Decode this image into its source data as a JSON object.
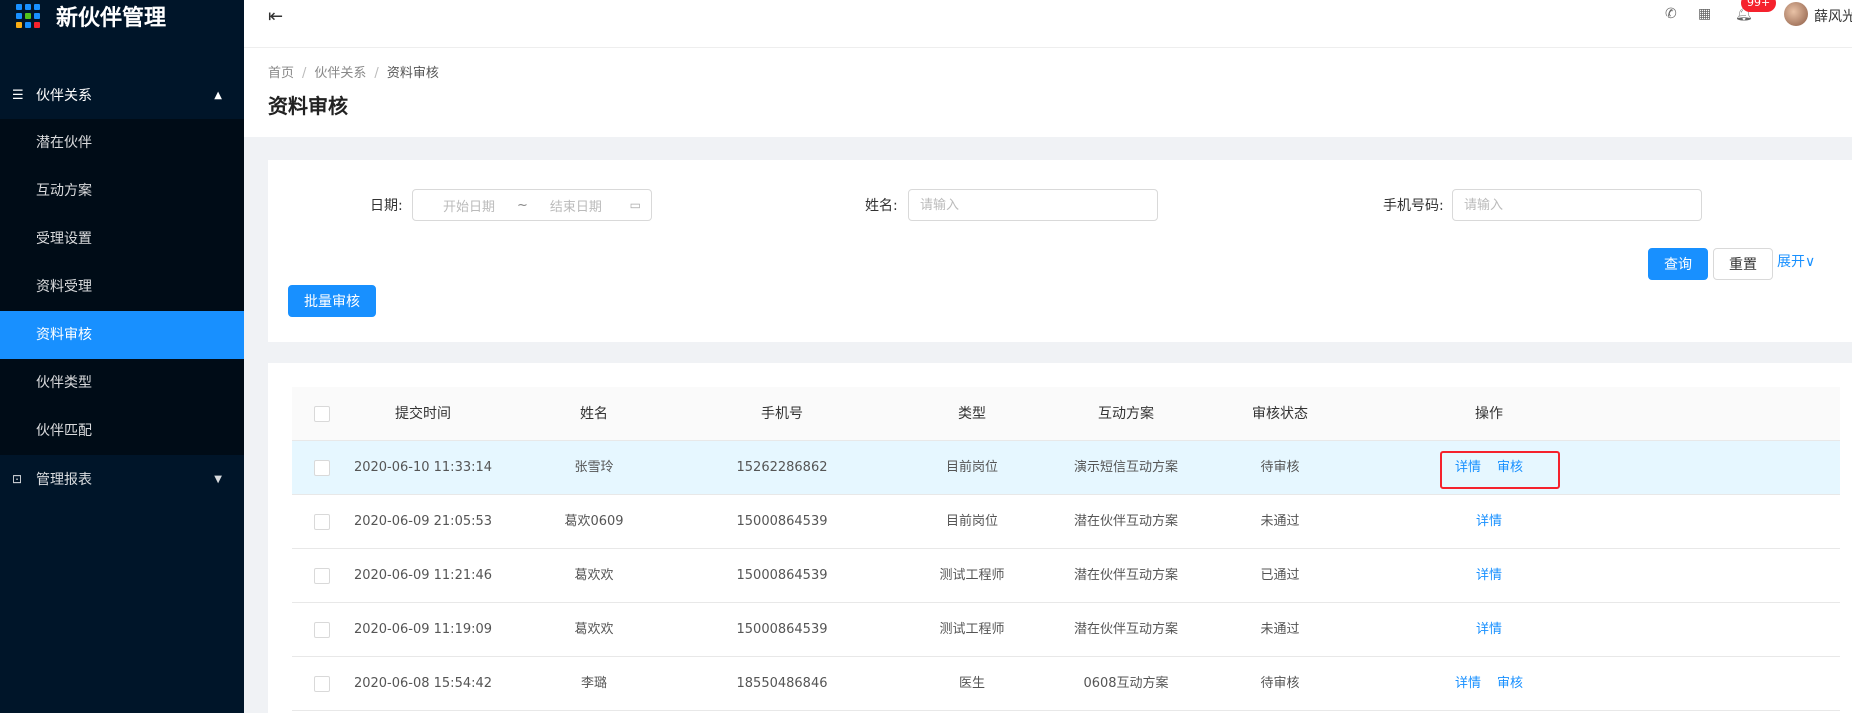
{
  "sidebar": {
    "logo_title": "新伙伴管理",
    "logo_colors": [
      "#1890ff",
      "#1890ff",
      "#1890ff",
      "#1890ff",
      "#52c41a",
      "#1890ff",
      "#faad14",
      "#1890ff",
      "#f5222d"
    ],
    "group1": "伙伴关系",
    "items": [
      {
        "label": "潜在伙伴",
        "active": false
      },
      {
        "label": "互动方案",
        "active": false
      },
      {
        "label": "受理设置",
        "active": false
      },
      {
        "label": "资料受理",
        "active": false
      },
      {
        "label": "资料审核",
        "active": true
      },
      {
        "label": "伙伴类型",
        "active": false
      },
      {
        "label": "伙伴匹配",
        "active": false
      }
    ],
    "group2": "管理报表"
  },
  "header": {
    "badge": "99+",
    "username": "薛风光"
  },
  "breadcrumb": [
    "首页",
    "伙伴关系",
    "资料审核"
  ],
  "page_title": "资料审核",
  "filter": {
    "date_label": "日期:",
    "start_placeholder": "开始日期",
    "range_sep": "~",
    "end_placeholder": "结束日期",
    "name_label": "姓名:",
    "name_placeholder": "请输入",
    "phone_label": "手机号码:",
    "phone_placeholder": "请输入",
    "query_button": "查询",
    "reset_button": "重置",
    "expand_link": "展开∨",
    "batch_button": "批量审核"
  },
  "table": {
    "columns": [
      "提交时间",
      "姓名",
      "手机号",
      "类型",
      "互动方案",
      "审核状态",
      "操作"
    ],
    "rows": [
      {
        "time": "2020-06-10 11:33:14",
        "name": "张雪玲",
        "phone": "15262286862",
        "type": "目前岗位",
        "plan": "演示短信互动方案",
        "status": "待审核",
        "ops": [
          "详情",
          "审核"
        ]
      },
      {
        "time": "2020-06-09 21:05:53",
        "name": "葛欢0609",
        "phone": "15000864539",
        "type": "目前岗位",
        "plan": "潜在伙伴互动方案",
        "status": "未通过",
        "ops": [
          "详情"
        ]
      },
      {
        "time": "2020-06-09 11:21:46",
        "name": "葛欢欢",
        "phone": "15000864539",
        "type": "测试工程师",
        "plan": "潜在伙伴互动方案",
        "status": "已通过",
        "ops": [
          "详情"
        ]
      },
      {
        "time": "2020-06-09 11:19:09",
        "name": "葛欢欢",
        "phone": "15000864539",
        "type": "测试工程师",
        "plan": "潜在伙伴互动方案",
        "status": "未通过",
        "ops": [
          "详情"
        ]
      },
      {
        "time": "2020-06-08 15:54:42",
        "name": "李璐",
        "phone": "18550486846",
        "type": "医生",
        "plan": "0608互动方案",
        "status": "待审核",
        "ops": [
          "详情",
          "审核"
        ]
      }
    ]
  }
}
